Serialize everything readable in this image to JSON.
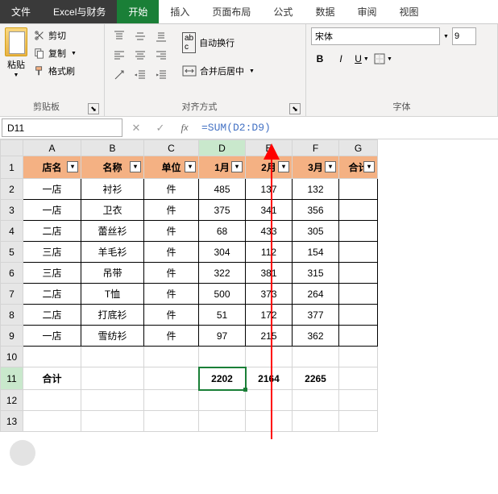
{
  "menu": {
    "tabs": [
      "文件",
      "Excel与财务",
      "开始",
      "插入",
      "页面布局",
      "公式",
      "数据",
      "审阅",
      "视图"
    ],
    "active_index": 2
  },
  "ribbon": {
    "clipboard": {
      "paste": "粘贴",
      "cut": "剪切",
      "copy": "复制",
      "format_painter": "格式刷",
      "group_label": "剪贴板"
    },
    "align": {
      "wrap": "自动换行",
      "merge": "合并后居中",
      "group_label": "对齐方式"
    },
    "font": {
      "name": "宋体",
      "size": "9",
      "group_label": "字体"
    }
  },
  "namebox": "D11",
  "formula": "=SUM(D2:D9)",
  "columns": [
    "A",
    "B",
    "C",
    "D",
    "E",
    "F",
    "G"
  ],
  "active_col_index": 3,
  "active_row": 11,
  "headers": [
    "店名",
    "名称",
    "单位",
    "1月",
    "2月",
    "3月",
    "合计"
  ],
  "rows": [
    {
      "r": 2,
      "c": [
        "一店",
        "衬衫",
        "件",
        "485",
        "137",
        "132",
        ""
      ]
    },
    {
      "r": 3,
      "c": [
        "一店",
        "卫衣",
        "件",
        "375",
        "341",
        "356",
        ""
      ]
    },
    {
      "r": 4,
      "c": [
        "二店",
        "蕾丝衫",
        "件",
        "68",
        "433",
        "305",
        ""
      ]
    },
    {
      "r": 5,
      "c": [
        "三店",
        "羊毛衫",
        "件",
        "304",
        "112",
        "154",
        ""
      ]
    },
    {
      "r": 6,
      "c": [
        "三店",
        "吊带",
        "件",
        "322",
        "381",
        "315",
        ""
      ]
    },
    {
      "r": 7,
      "c": [
        "二店",
        "T恤",
        "件",
        "500",
        "373",
        "264",
        ""
      ]
    },
    {
      "r": 8,
      "c": [
        "二店",
        "打底衫",
        "件",
        "51",
        "172",
        "377",
        ""
      ]
    },
    {
      "r": 9,
      "c": [
        "一店",
        "雪纺衫",
        "件",
        "97",
        "215",
        "362",
        ""
      ]
    }
  ],
  "total_row": {
    "r": 11,
    "label": "合计",
    "d": "2202",
    "e": "2164",
    "f": "2265"
  },
  "chart_data": {
    "type": "table",
    "title": "",
    "columns": [
      "店名",
      "名称",
      "单位",
      "1月",
      "2月",
      "3月",
      "合计"
    ],
    "data": [
      [
        "一店",
        "衬衫",
        "件",
        485,
        137,
        132,
        null
      ],
      [
        "一店",
        "卫衣",
        "件",
        375,
        341,
        356,
        null
      ],
      [
        "二店",
        "蕾丝衫",
        "件",
        68,
        433,
        305,
        null
      ],
      [
        "三店",
        "羊毛衫",
        "件",
        304,
        112,
        154,
        null
      ],
      [
        "三店",
        "吊带",
        "件",
        322,
        381,
        315,
        null
      ],
      [
        "二店",
        "T恤",
        "件",
        500,
        373,
        264,
        null
      ],
      [
        "二店",
        "打底衫",
        "件",
        51,
        172,
        377,
        null
      ],
      [
        "一店",
        "雪纺衫",
        "件",
        97,
        215,
        362,
        null
      ]
    ],
    "totals": {
      "1月": 2202,
      "2月": 2164,
      "3月": 2265
    }
  }
}
